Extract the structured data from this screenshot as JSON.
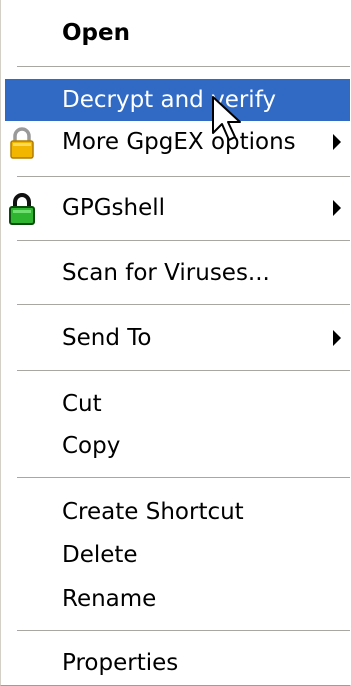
{
  "menu": {
    "items": [
      {
        "label": "Open"
      },
      {
        "label": "Decrypt and verify"
      },
      {
        "label": "More GpgEX options"
      },
      {
        "label": "GPGshell"
      },
      {
        "label": "Scan for Viruses..."
      },
      {
        "label": "Send To"
      },
      {
        "label": "Cut"
      },
      {
        "label": "Copy"
      },
      {
        "label": "Create Shortcut"
      },
      {
        "label": "Delete"
      },
      {
        "label": "Rename"
      },
      {
        "label": "Properties"
      }
    ]
  },
  "icons": {
    "gpgex": "padlock-icon",
    "gpgshell": "green-padlock-icon",
    "cursor": "mouse-pointer-icon"
  },
  "colors": {
    "highlight": "#316ac5",
    "highlight_text": "#ffffff",
    "text": "#000000"
  }
}
